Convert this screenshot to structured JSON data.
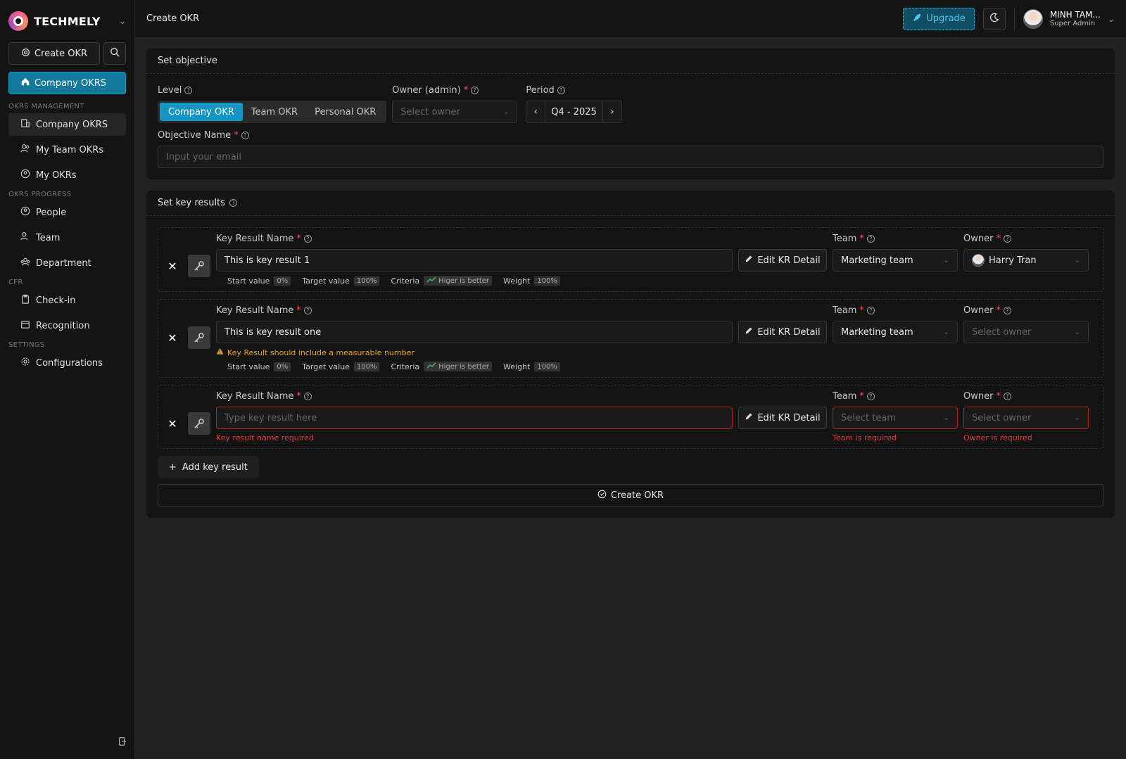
{
  "brand": {
    "name": "TECHMELY"
  },
  "sidebar": {
    "create_label": "Create OKR",
    "active_main": "Company OKRS",
    "sections": [
      {
        "label": "OKRS MANAGEMENT",
        "items": [
          "Company OKRS",
          "My Team OKRs",
          "My OKRs"
        ]
      },
      {
        "label": "OKRS PROGRESS",
        "items": [
          "People",
          "Team",
          "Department"
        ]
      },
      {
        "label": "CFR",
        "items": [
          "Check-in",
          "Recognition"
        ]
      },
      {
        "label": "SETTINGS",
        "items": [
          "Configurations"
        ]
      }
    ]
  },
  "header": {
    "title": "Create OKR",
    "upgrade_label": "Upgrade",
    "user_name": "MINH TAM...",
    "user_role": "Super Admin"
  },
  "objective": {
    "title": "Set objective",
    "level_label": "Level",
    "levels": [
      "Company OKR",
      "Team OKR",
      "Personal OKR"
    ],
    "owner_label": "Owner (admin)",
    "owner_placeholder": "Select owner",
    "period_label": "Period",
    "period_value": "Q4 - 2025",
    "name_label": "Objective Name",
    "name_placeholder": "Input your email"
  },
  "key_results": {
    "title": "Set key results",
    "name_label": "Key Result Name",
    "team_label": "Team",
    "owner_label": "Owner",
    "edit_label": "Edit KR Detail",
    "meta_labels": {
      "start": "Start value",
      "target": "Target value",
      "criteria": "Criteria",
      "weight": "Weight"
    },
    "items": [
      {
        "name": "This is key result 1",
        "team": "Marketing team",
        "owner": "Harry Tran",
        "start": "0%",
        "target": "100%",
        "criteria": "Higer is better",
        "weight": "100%"
      },
      {
        "name": "This is key result one",
        "warning": "Key Result should include a measurable number",
        "team": "Marketing team",
        "owner_placeholder": "Select owner",
        "start": "0%",
        "target": "100%",
        "criteria": "Higer is better",
        "weight": "100%"
      },
      {
        "name_placeholder": "Type key result here",
        "name_error": "Key result name required",
        "team_placeholder": "Select team",
        "team_error": "Team is required",
        "owner_placeholder": "Select owner",
        "owner_error": "Owner is required"
      }
    ],
    "add_label": "Add key result",
    "submit_label": "Create OKR"
  },
  "colors": {
    "accent": "#1595c4",
    "error": "#e03b3b",
    "warning": "#e6a51a",
    "success": "#3fbf6f"
  }
}
